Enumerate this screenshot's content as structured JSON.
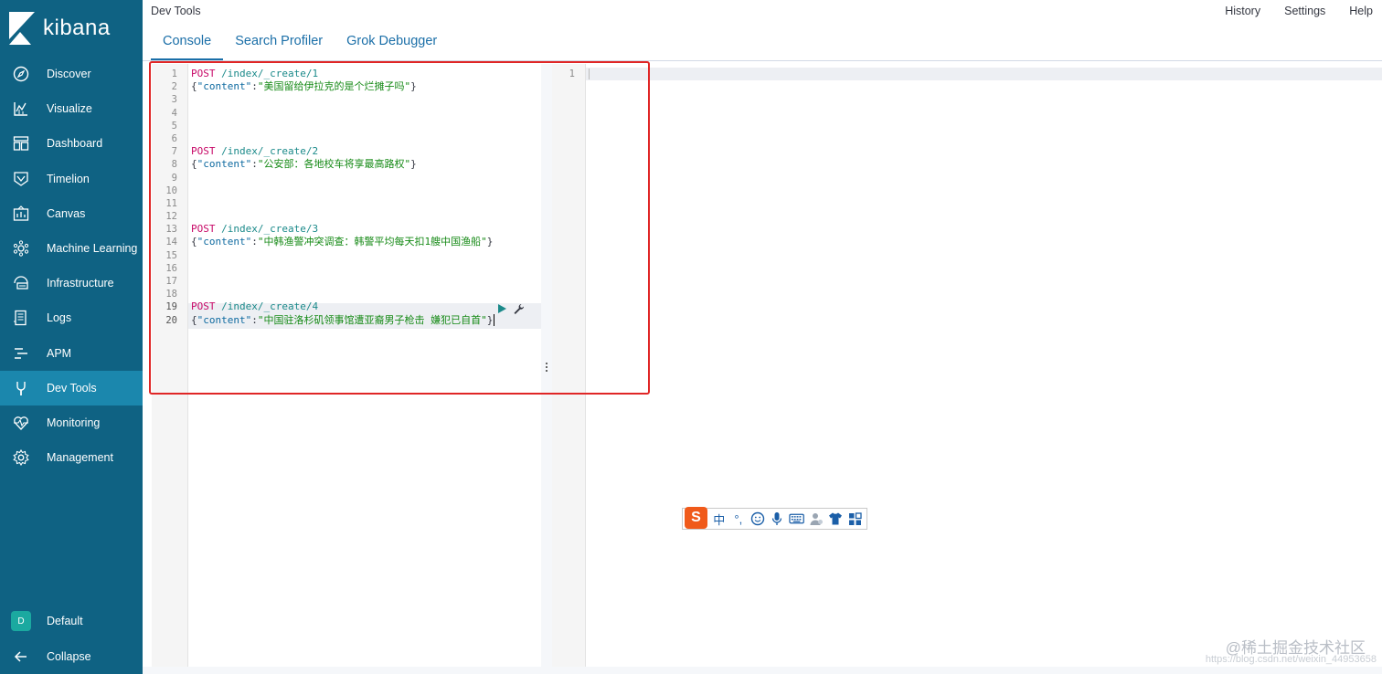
{
  "app": {
    "logo_text": "kibana",
    "title": "Dev Tools"
  },
  "sidebar": {
    "items": [
      {
        "label": "Discover",
        "icon": "compass-icon"
      },
      {
        "label": "Visualize",
        "icon": "chart-icon"
      },
      {
        "label": "Dashboard",
        "icon": "dashboard-icon"
      },
      {
        "label": "Timelion",
        "icon": "timelion-icon"
      },
      {
        "label": "Canvas",
        "icon": "canvas-icon"
      },
      {
        "label": "Machine Learning",
        "icon": "ml-icon"
      },
      {
        "label": "Infrastructure",
        "icon": "infrastructure-icon"
      },
      {
        "label": "Logs",
        "icon": "logs-icon"
      },
      {
        "label": "APM",
        "icon": "apm-icon"
      },
      {
        "label": "Dev Tools",
        "icon": "wrench-icon",
        "active": true
      },
      {
        "label": "Monitoring",
        "icon": "heartbeat-icon"
      },
      {
        "label": "Management",
        "icon": "gear-icon"
      }
    ],
    "space_avatar": "D",
    "space_label": "Default",
    "collapse_label": "Collapse"
  },
  "header": {
    "links": [
      "History",
      "Settings",
      "Help"
    ],
    "tabs": [
      {
        "label": "Console",
        "active": true
      },
      {
        "label": "Search Profiler",
        "active": false
      },
      {
        "label": "Grok Debugger",
        "active": false
      }
    ]
  },
  "console": {
    "line_count": 20,
    "active_lines": [
      19,
      20
    ],
    "requests": [
      {
        "line": 1,
        "method": "POST",
        "path": "/index/_create/1",
        "key": "\"content\"",
        "value": "\"美国留给伊拉克的是个烂摊子吗\""
      },
      {
        "line": 7,
        "method": "POST",
        "path": "/index/_create/2",
        "key": "\"content\"",
        "value": "\"公安部：各地校车将享最高路权\""
      },
      {
        "line": 13,
        "method": "POST",
        "path": "/index/_create/3",
        "key": "\"content\"",
        "value": "\"中韩渔警冲突调查：韩警平均每天扣1艘中国渔船\""
      },
      {
        "line": 19,
        "method": "POST",
        "path": "/index/_create/4",
        "key": "\"content\"",
        "value": "\"中国驻洛杉矶领事馆遭亚裔男子枪击 嫌犯已自首\""
      }
    ],
    "output_line_count": 1
  },
  "ime": {
    "logo": "S",
    "items": [
      "中",
      "°,"
    ]
  },
  "watermark": {
    "text": "@稀土掘金技术社区",
    "url": "https://blog.csdn.net/weixin_44953658"
  },
  "colors": {
    "sidebar_bg": "#0f6283",
    "sidebar_active": "#1b87ad",
    "tab_blue": "#1b6fa8",
    "highlight_red": "#e02626"
  }
}
